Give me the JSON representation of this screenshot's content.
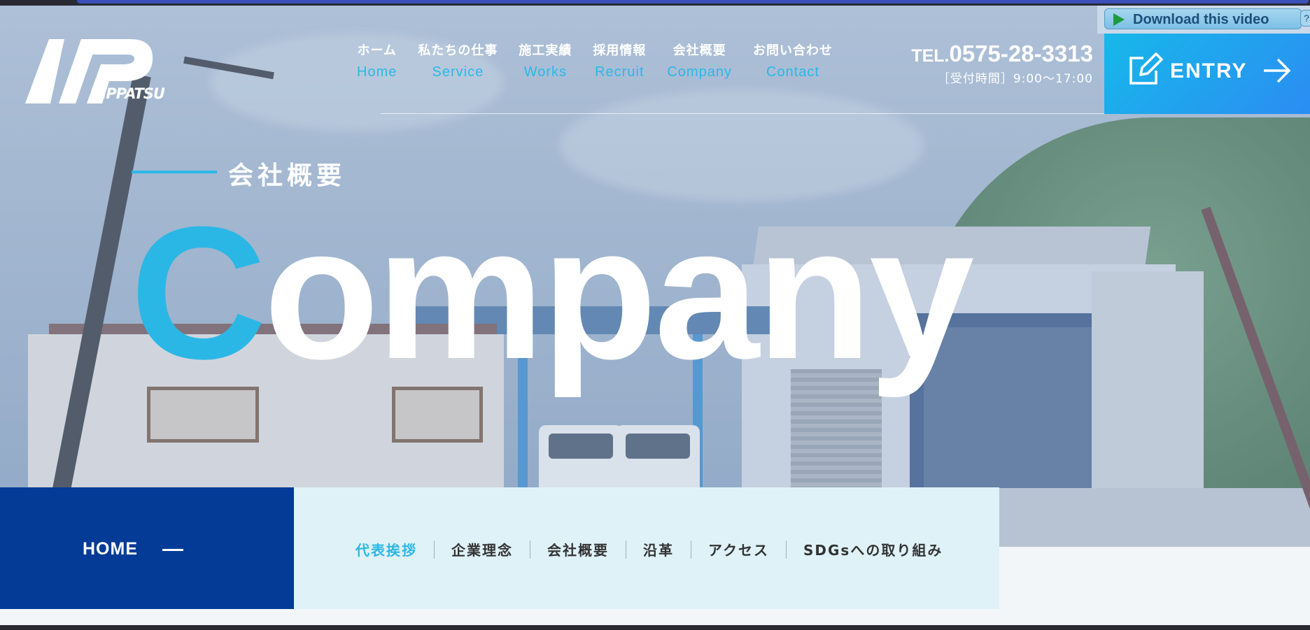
{
  "browser_overlay": {
    "download_label": "Download this video",
    "help_label": "?"
  },
  "header": {
    "logo_text": "NIPPATSU",
    "nav": [
      {
        "jp": "ホーム",
        "en": "Home"
      },
      {
        "jp": "私たちの仕事",
        "en": "Service"
      },
      {
        "jp": "施工実績",
        "en": "Works"
      },
      {
        "jp": "採用情報",
        "en": "Recruit"
      },
      {
        "jp": "会社概要",
        "en": "Company"
      },
      {
        "jp": "お問い合わせ",
        "en": "Contact"
      }
    ],
    "tel": {
      "prefix": "TEL.",
      "number": "0575-28-3313",
      "hours": "［受付時間］9:00〜17:00"
    },
    "entry_label": "ENTRY"
  },
  "hero": {
    "subtitle": "会社概要",
    "title_first": "C",
    "title_rest": "ompany"
  },
  "page_nav": {
    "home_label": "HOME",
    "items": [
      "代表挨拶",
      "企業理念",
      "会社概要",
      "沿革",
      "アクセス",
      "SDGsへの取り組み"
    ],
    "active_index": 0
  },
  "colors": {
    "accent": "#2bb7e6",
    "navy": "#033b97",
    "subnav_bg": "#dff2f8"
  }
}
